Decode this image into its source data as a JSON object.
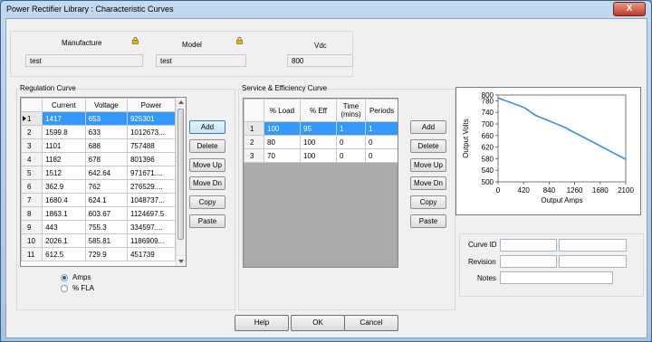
{
  "window": {
    "title": "Power Rectifier Library : Characteristic Curves",
    "close_label": "X"
  },
  "header": {
    "manufacture_label": "Manufacture",
    "manufacture_value": "test",
    "model_label": "Model",
    "model_value": "test",
    "vdc_label": "Vdc",
    "vdc_value": "800"
  },
  "regulation": {
    "title": "Regulation Curve",
    "columns": [
      "Current",
      "Voltage",
      "Power"
    ],
    "rows": [
      [
        "1",
        "1417",
        "653",
        "925301"
      ],
      [
        "2",
        "1599.8",
        "633",
        "1012673..."
      ],
      [
        "3",
        "1101",
        "688",
        "757488"
      ],
      [
        "4",
        "1182",
        "678",
        "801396"
      ],
      [
        "5",
        "1512",
        "642.64",
        "971671...."
      ],
      [
        "6",
        "362.9",
        "762",
        "276529...."
      ],
      [
        "7",
        "1680.4",
        "624.1",
        "1048737..."
      ],
      [
        "8",
        "1863.1",
        "603.67",
        "1124697.5"
      ],
      [
        "9",
        "443",
        "755.3",
        "334597...."
      ],
      [
        "10",
        "2026.1",
        "585.81",
        "1186909..."
      ],
      [
        "11",
        "612.5",
        "729.9",
        "451739"
      ]
    ],
    "buttons": [
      "Add",
      "Delete",
      "Move Up",
      "Move Dn",
      "Copy",
      "Paste"
    ],
    "radio_amps": "Amps",
    "radio_fla": "% FLA"
  },
  "service": {
    "title": "Service & Efficiency Curve",
    "columns": [
      "% Load",
      "% Eff",
      "Time (mins)",
      "Periods"
    ],
    "rows": [
      [
        "1",
        "100",
        "95",
        "1",
        "1"
      ],
      [
        "2",
        "80",
        "100",
        "0",
        "0"
      ],
      [
        "3",
        "70",
        "100",
        "0",
        "0"
      ]
    ],
    "buttons": [
      "Add",
      "Delete",
      "Move Up",
      "Move Dn",
      "Copy",
      "Paste"
    ]
  },
  "chart_data": {
    "type": "line",
    "xlabel": "Output Amps",
    "ylabel": "Output Volts",
    "xlim": [
      0,
      2100
    ],
    "ylim": [
      500,
      800
    ],
    "xticks": [
      0,
      420,
      840,
      1260,
      1680,
      2100
    ],
    "yticks": [
      500,
      540,
      580,
      620,
      660,
      700,
      740,
      780,
      800
    ],
    "color": "#3d8fd6",
    "series": [
      {
        "x": [
          0,
          362.9,
          443,
          612.5,
          1101,
          1182,
          1417,
          1512,
          1599.8,
          1680.4,
          1863.1,
          2026.1,
          2100
        ],
        "y": [
          790,
          762,
          755.3,
          729.9,
          688,
          678,
          653,
          642.64,
          633,
          624.1,
          603.67,
          585.81,
          578
        ]
      }
    ]
  },
  "curve_info": {
    "curve_id_label": "Curve ID",
    "revision_label": "Revision",
    "notes_label": "Notes"
  },
  "footer": {
    "help": "Help",
    "ok": "OK",
    "cancel": "Cancel"
  }
}
